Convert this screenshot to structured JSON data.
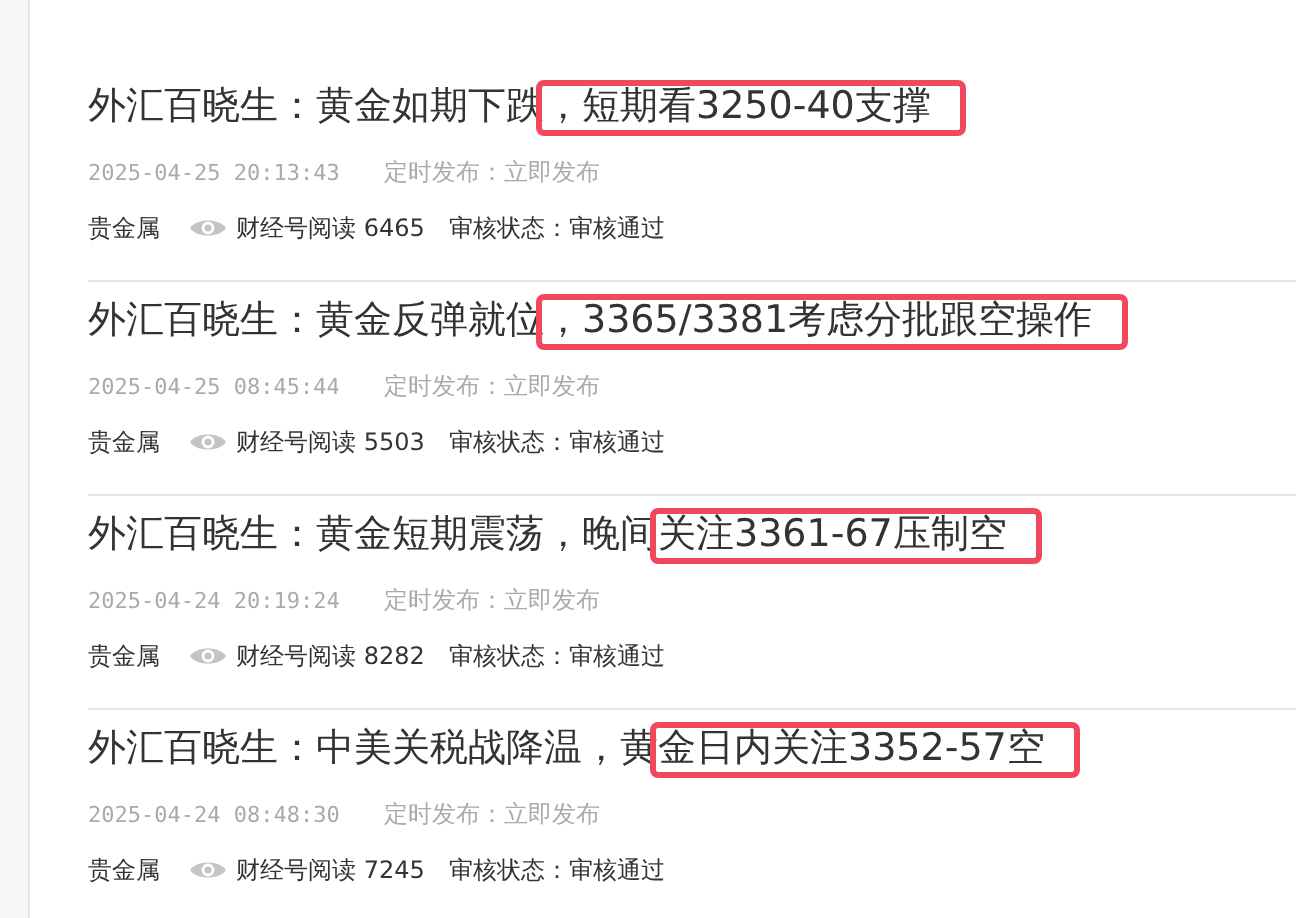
{
  "articles": [
    {
      "title_lead": "外汇百晓生：黄金如期下跌",
      "title_marked": "，短期看3250-40支撑",
      "date": "2025-04-25 20:13:43",
      "schedule": "定时发布：立即发布",
      "tag": "贵金属",
      "reads": "财经号阅读 6465",
      "review": "审核状态：审核通过"
    },
    {
      "title_lead": "外汇百晓生：黄金反弹就位",
      "title_marked": "，3365/3381考虑分批跟空操作",
      "date": "2025-04-25 08:45:44",
      "schedule": "定时发布：立即发布",
      "tag": "贵金属",
      "reads": "财经号阅读 5503",
      "review": "审核状态：审核通过"
    },
    {
      "title_lead": "外汇百晓生：黄金短期震荡，晚间",
      "title_marked": "关注3361-67压制空",
      "date": "2025-04-24 20:19:24",
      "schedule": "定时发布：立即发布",
      "tag": "贵金属",
      "reads": "财经号阅读 8282",
      "review": "审核状态：审核通过"
    },
    {
      "title_lead": "外汇百晓生：中美关税战降温，黄",
      "title_marked": "金日内关注3352-57空",
      "date": "2025-04-24 08:48:30",
      "schedule": "定时发布：立即发布",
      "tag": "贵金属",
      "reads": "财经号阅读 7245",
      "review": "审核状态：审核通过"
    }
  ]
}
